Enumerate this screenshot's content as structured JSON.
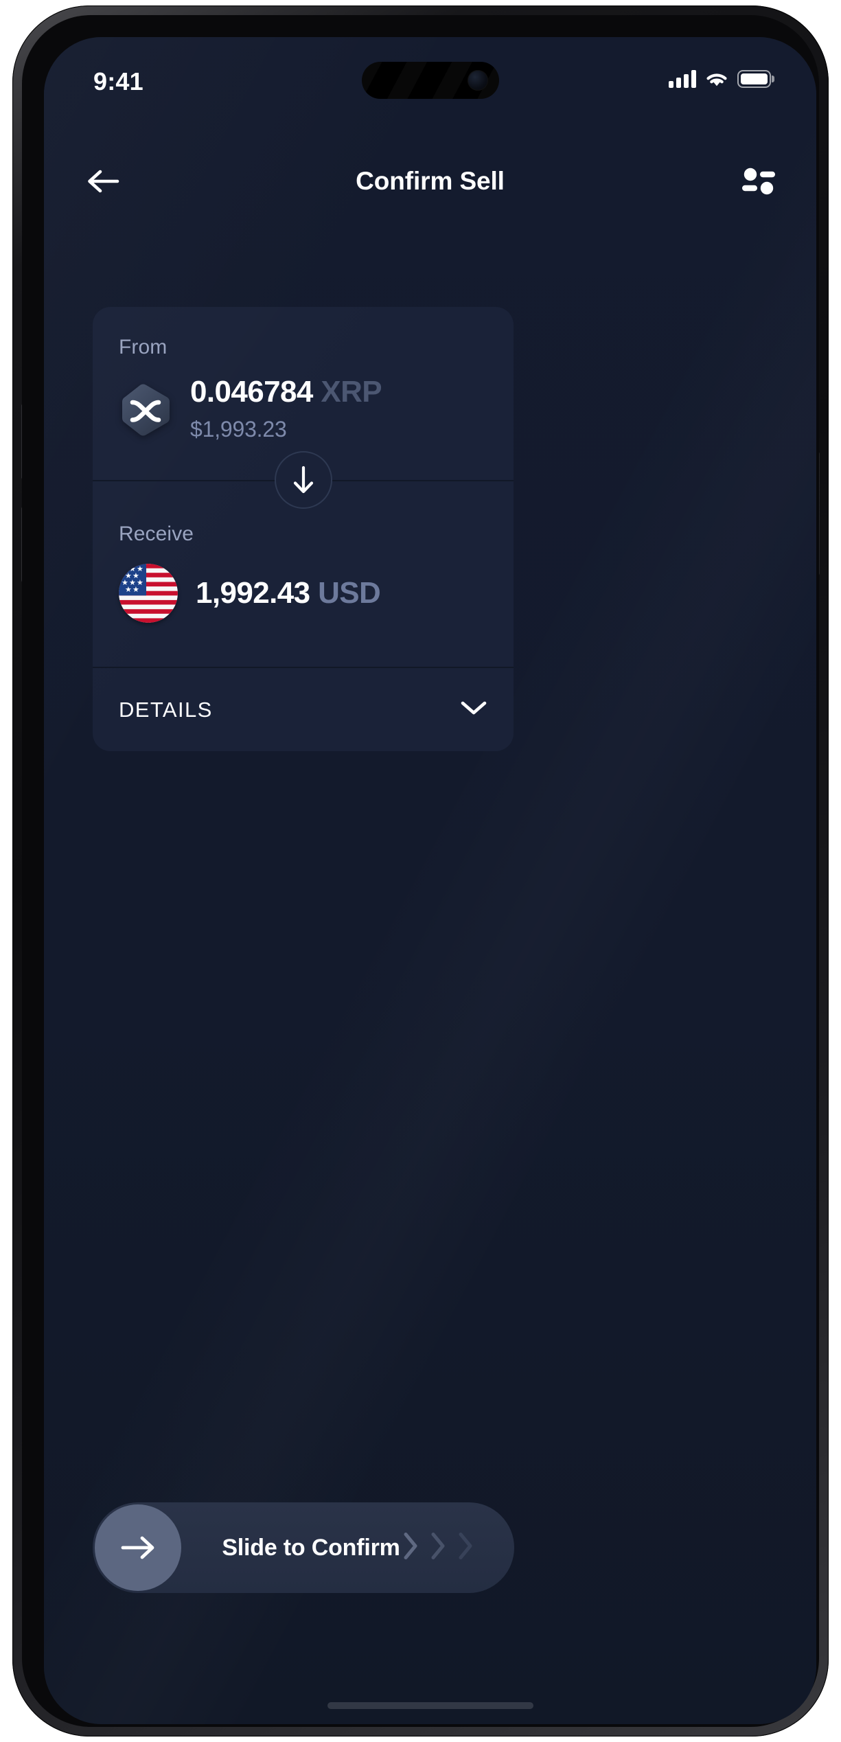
{
  "status_bar": {
    "time": "9:41",
    "signal_icon": "cellular-signal-icon",
    "wifi_icon": "wifi-icon",
    "battery_icon": "battery-full-icon",
    "battery_level_pct": 100
  },
  "header": {
    "back_icon": "arrow-left-icon",
    "title": "Confirm Sell",
    "settings_icon": "sliders-icon"
  },
  "swap": {
    "from": {
      "label": "From",
      "token_icon": "xrp-token-icon",
      "amount": "0.046784",
      "ticker": "XRP",
      "fiat_value": "$1,993.23"
    },
    "swap_arrow_icon": "arrow-down-icon",
    "receive": {
      "label": "Receive",
      "token_icon": "usd-flag-icon",
      "amount": "1,992.43",
      "ticker": "USD"
    },
    "details": {
      "label": "DETAILS",
      "chevron_icon": "chevron-down-icon",
      "expanded": false
    }
  },
  "slide_confirm": {
    "label": "Slide to Confirm",
    "thumb_icon": "arrow-right-icon",
    "chevron_icon": "chevron-right-icon",
    "chevron_count": 3
  },
  "colors": {
    "screen_background": "#141b2e",
    "card_background": "#1a2238",
    "divider": "#111827",
    "text_primary": "#ffffff",
    "label_muted": "#9aa4c0",
    "ticker_xrp": "#4c5772",
    "ticker_usd": "#6d7a9c",
    "fiat_text": "#7e8aab",
    "slider_track": "#2a3348",
    "slider_thumb": "#5c6781",
    "flag_red": "#c8102e",
    "flag_blue": "#1d4289"
  }
}
